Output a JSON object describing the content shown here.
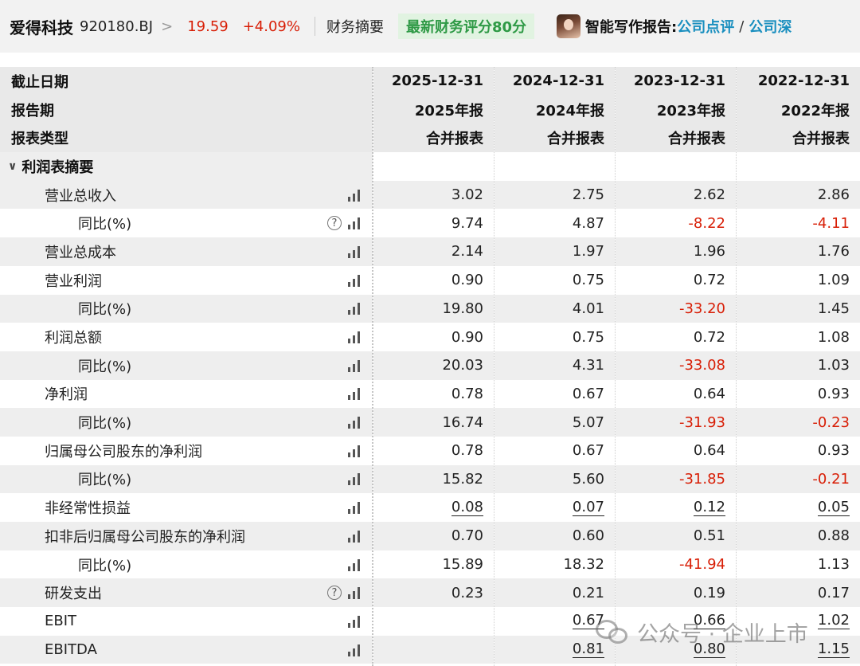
{
  "header": {
    "company": "爱得科技",
    "code": "920180.BJ",
    "arrow": ">",
    "price": "19.59",
    "change": "+4.09%",
    "section": "财务摘要",
    "score": "最新财务评分80分",
    "report_label": "智能写作报告:",
    "link1": "公司点评",
    "slash": "/",
    "link2": "公司深"
  },
  "table": {
    "header_rows": [
      {
        "label": "截止日期",
        "values": [
          "2025-12-31",
          "2024-12-31",
          "2023-12-31",
          "2022-12-31"
        ]
      },
      {
        "label": "报告期",
        "values": [
          "2025年报",
          "2024年报",
          "2023年报",
          "2022年报"
        ]
      },
      {
        "label": "报表类型",
        "values": [
          "合并报表",
          "合并报表",
          "合并报表",
          "合并报表"
        ]
      }
    ],
    "section": {
      "chevron": "∨",
      "label": "利润表摘要"
    },
    "rows": [
      {
        "label": "营业总收入",
        "level": 1,
        "help": false,
        "values": [
          "3.02",
          "2.75",
          "2.62",
          "2.86"
        ],
        "neg": [
          false,
          false,
          false,
          false
        ],
        "underline": false
      },
      {
        "label": "同比(%)",
        "level": 2,
        "help": true,
        "values": [
          "9.74",
          "4.87",
          "-8.22",
          "-4.11"
        ],
        "neg": [
          false,
          false,
          true,
          true
        ],
        "underline": false
      },
      {
        "label": "营业总成本",
        "level": 1,
        "help": false,
        "values": [
          "2.14",
          "1.97",
          "1.96",
          "1.76"
        ],
        "neg": [
          false,
          false,
          false,
          false
        ],
        "underline": false
      },
      {
        "label": "营业利润",
        "level": 1,
        "help": false,
        "values": [
          "0.90",
          "0.75",
          "0.72",
          "1.09"
        ],
        "neg": [
          false,
          false,
          false,
          false
        ],
        "underline": false
      },
      {
        "label": "同比(%)",
        "level": 2,
        "help": false,
        "values": [
          "19.80",
          "4.01",
          "-33.20",
          "1.45"
        ],
        "neg": [
          false,
          false,
          true,
          false
        ],
        "underline": false
      },
      {
        "label": "利润总额",
        "level": 1,
        "help": false,
        "values": [
          "0.90",
          "0.75",
          "0.72",
          "1.08"
        ],
        "neg": [
          false,
          false,
          false,
          false
        ],
        "underline": false
      },
      {
        "label": "同比(%)",
        "level": 2,
        "help": false,
        "values": [
          "20.03",
          "4.31",
          "-33.08",
          "1.03"
        ],
        "neg": [
          false,
          false,
          true,
          false
        ],
        "underline": false
      },
      {
        "label": "净利润",
        "level": 1,
        "help": false,
        "values": [
          "0.78",
          "0.67",
          "0.64",
          "0.93"
        ],
        "neg": [
          false,
          false,
          false,
          false
        ],
        "underline": false
      },
      {
        "label": "同比(%)",
        "level": 2,
        "help": false,
        "values": [
          "16.74",
          "5.07",
          "-31.93",
          "-0.23"
        ],
        "neg": [
          false,
          false,
          true,
          true
        ],
        "underline": false
      },
      {
        "label": "归属母公司股东的净利润",
        "level": 1,
        "help": false,
        "values": [
          "0.78",
          "0.67",
          "0.64",
          "0.93"
        ],
        "neg": [
          false,
          false,
          false,
          false
        ],
        "underline": false
      },
      {
        "label": "同比(%)",
        "level": 2,
        "help": false,
        "values": [
          "15.82",
          "5.60",
          "-31.85",
          "-0.21"
        ],
        "neg": [
          false,
          false,
          true,
          true
        ],
        "underline": false
      },
      {
        "label": "非经常性损益",
        "level": 1,
        "help": false,
        "values": [
          "0.08",
          "0.07",
          "0.12",
          "0.05"
        ],
        "neg": [
          false,
          false,
          false,
          false
        ],
        "underline": true
      },
      {
        "label": "扣非后归属母公司股东的净利润",
        "level": 1,
        "help": false,
        "values": [
          "0.70",
          "0.60",
          "0.51",
          "0.88"
        ],
        "neg": [
          false,
          false,
          false,
          false
        ],
        "underline": false
      },
      {
        "label": "同比(%)",
        "level": 2,
        "help": false,
        "values": [
          "15.89",
          "18.32",
          "-41.94",
          "1.13"
        ],
        "neg": [
          false,
          false,
          true,
          false
        ],
        "underline": false
      },
      {
        "label": "研发支出",
        "level": 1,
        "help": true,
        "values": [
          "0.23",
          "0.21",
          "0.19",
          "0.17"
        ],
        "neg": [
          false,
          false,
          false,
          false
        ],
        "underline": false
      },
      {
        "label": "EBIT",
        "level": 1,
        "help": false,
        "values": [
          "",
          "0.67",
          "0.66",
          "1.02"
        ],
        "neg": [
          false,
          false,
          false,
          false
        ],
        "underline": true
      },
      {
        "label": "EBITDA",
        "level": 1,
        "help": false,
        "values": [
          "",
          "0.81",
          "0.80",
          "1.15"
        ],
        "neg": [
          false,
          false,
          false,
          false
        ],
        "underline": true
      }
    ]
  },
  "icons": {
    "help": "question-circle-icon",
    "chart": "bar-chart-icon",
    "help_glyph": "?"
  },
  "watermark": "公众号 · 企业上市",
  "colors": {
    "negative": "#d81e06",
    "link": "#1a8fbf",
    "score": "#2f9a46",
    "score_bg": "#e1f3e1"
  }
}
